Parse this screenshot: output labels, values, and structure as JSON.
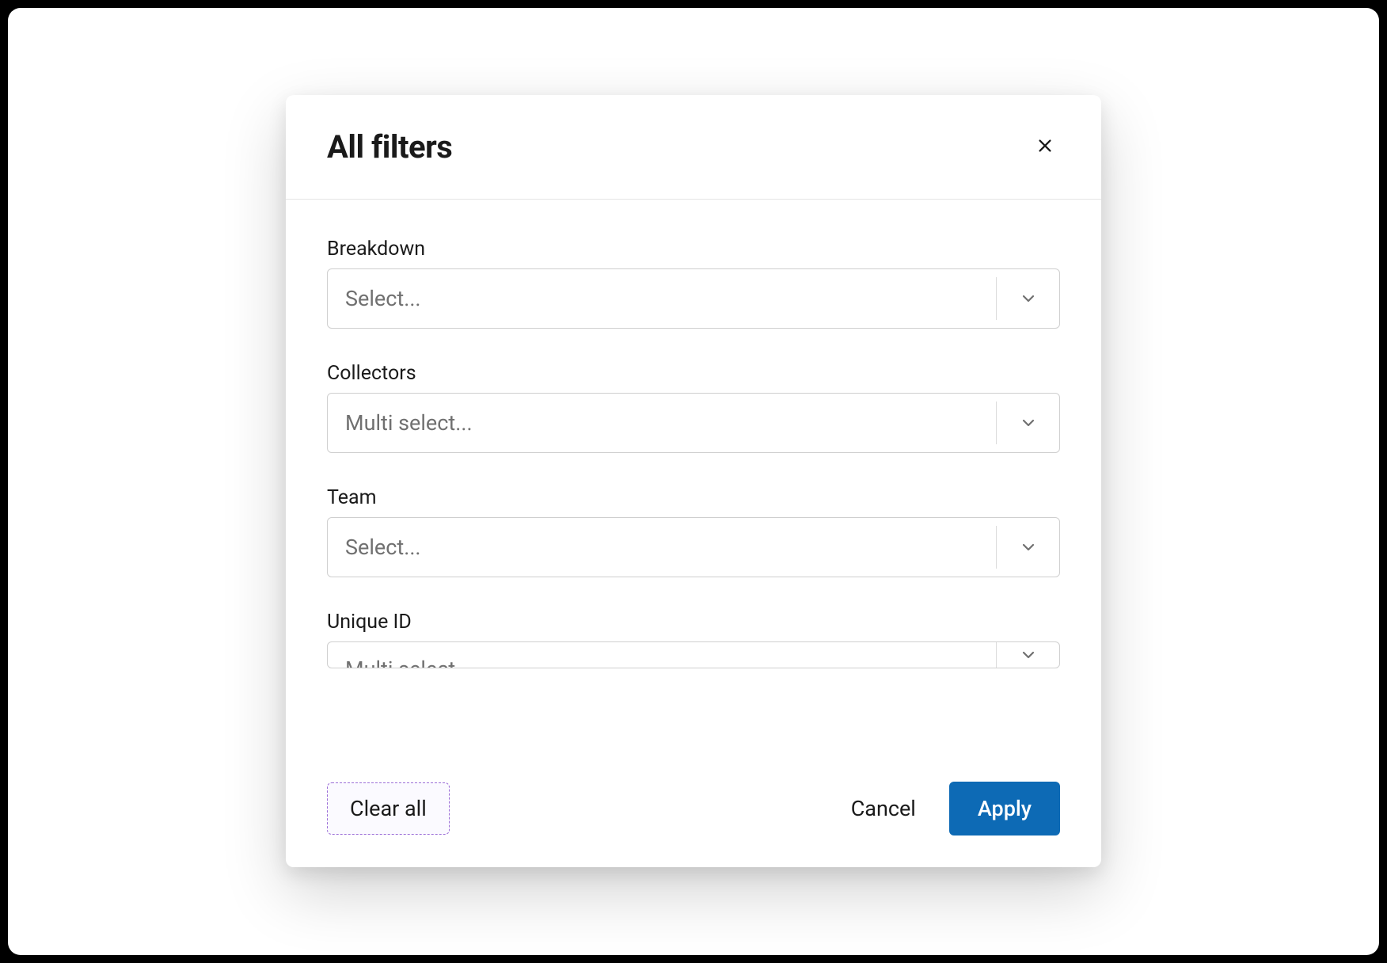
{
  "modal": {
    "title": "All filters",
    "fields": [
      {
        "label": "Breakdown",
        "placeholder": "Select..."
      },
      {
        "label": "Collectors",
        "placeholder": "Multi select..."
      },
      {
        "label": "Team",
        "placeholder": "Select..."
      },
      {
        "label": "Unique ID",
        "placeholder": "Multi select..."
      }
    ],
    "footer": {
      "clear_label": "Clear all",
      "cancel_label": "Cancel",
      "apply_label": "Apply"
    }
  }
}
